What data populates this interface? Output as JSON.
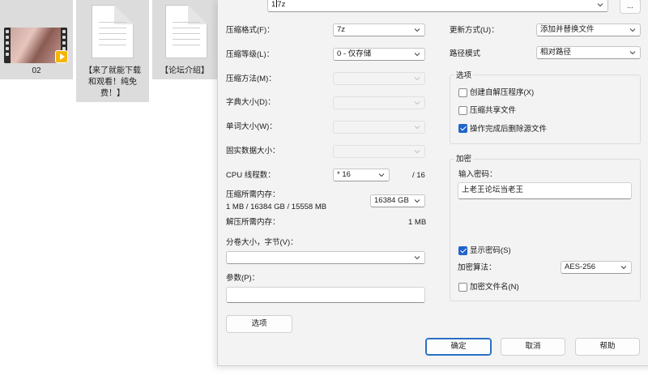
{
  "desktop": {
    "icons": [
      {
        "label": "02"
      },
      {
        "label": "【来了就能下载和观看！纯免费！】"
      },
      {
        "label": "【论坛介绍】"
      }
    ]
  },
  "dialog": {
    "archive_name": {
      "value_a": "1",
      "value_b": "7z"
    },
    "browse_label": "...",
    "left": {
      "format": {
        "label": "压缩格式(F)：",
        "value": "7z"
      },
      "level": {
        "label": "压缩等级(L)：",
        "value": "0 - 仅存储"
      },
      "method": {
        "label": "压缩方法(M)："
      },
      "dict": {
        "label": "字典大小(D)："
      },
      "word": {
        "label": "单词大小(W)："
      },
      "solid": {
        "label": "固实数据大小："
      },
      "cpu": {
        "label": "CPU 线程数：",
        "value": "* 16",
        "total": "/ 16"
      },
      "mem_compress": {
        "label": "压缩所需内存：",
        "detail": "1 MB / 16384 GB / 15558 MB",
        "value": "16384 GB"
      },
      "mem_decompress": {
        "label": "解压所需内存：",
        "value": "1 MB"
      },
      "split": {
        "label": "分卷大小，字节(V)："
      },
      "params": {
        "label": "参数(P)："
      },
      "options_button": "选项"
    },
    "right": {
      "update": {
        "label": "更新方式(U)：",
        "value": "添加并替换文件"
      },
      "path": {
        "label": "路径模式",
        "value": "相对路径"
      },
      "options_group": {
        "title": "选项",
        "sfx": {
          "label": "创建自解压程序(X)",
          "checked": false
        },
        "shared": {
          "label": "压缩共享文件",
          "checked": false
        },
        "delete": {
          "label": "操作完成后删除源文件",
          "checked": true
        }
      },
      "encrypt_group": {
        "title": "加密",
        "pw_label": "输入密码：",
        "pw_value": "上老王论坛当老王",
        "show_pw": {
          "label": "显示密码(S)",
          "checked": true
        },
        "method_label": "加密算法：",
        "method_value": "AES-256",
        "encrypt_names": {
          "label": "加密文件名(N)",
          "checked": false
        }
      }
    },
    "buttons": {
      "ok": "确定",
      "cancel": "取消",
      "help": "帮助"
    }
  }
}
